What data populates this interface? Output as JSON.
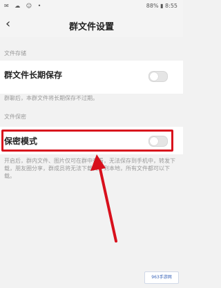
{
  "status_bar": {
    "left_icons": "✉ ☁ ☺ •",
    "right_text": "88% ▮ 8:55"
  },
  "header": {
    "title": "群文件设置"
  },
  "sections": {
    "storage_header": "文件存储",
    "long_term_label": "群文件长期保存",
    "long_term_desc": "群聊后，本群文件将长期保存不过期。",
    "security_header": "文件保密",
    "secret_mode_label": "保密模式",
    "secret_mode_desc": "开启后，群内文件、图片仅可在群中查看，无法保存到手机中，转发下载，朋友圈分享，群成员将无法下载文件到本地，所有文件都可以下载。"
  },
  "watermark": {
    "text": "963手游网"
  },
  "colors": {
    "highlight": "#d8101c",
    "arrow": "#d8101c"
  }
}
